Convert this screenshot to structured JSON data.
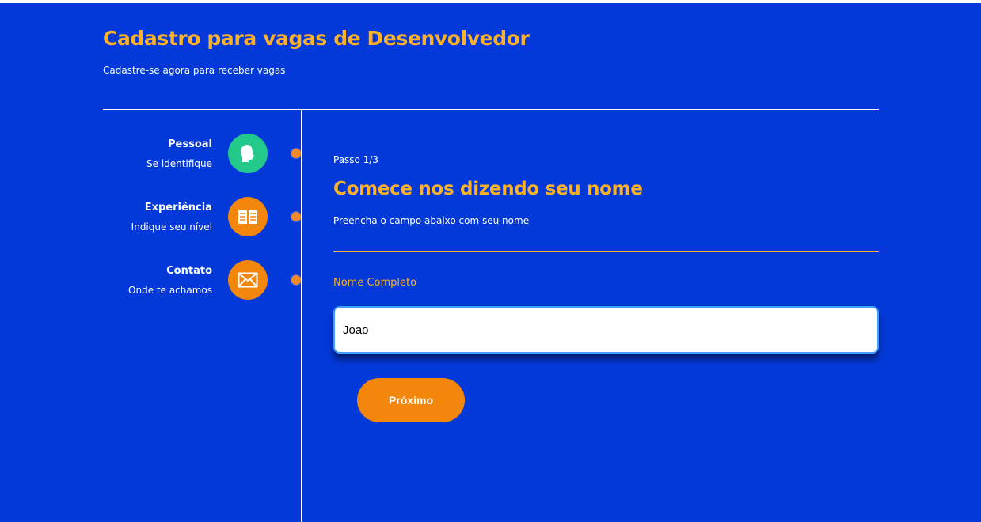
{
  "header": {
    "title": "Cadastro para vagas de Desenvolvedor",
    "subtitle": "Cadastre-se agora para receber vagas"
  },
  "steps": [
    {
      "name": "Pessoal",
      "description": "Se identifique",
      "icon": "person-head-icon",
      "color": "#22c98a"
    },
    {
      "name": "Experiência",
      "description": "Indique seu nível",
      "icon": "book-icon",
      "color": "#f2870c"
    },
    {
      "name": "Contato",
      "description": "Onde te achamos",
      "icon": "envelope-icon",
      "color": "#f2870c"
    }
  ],
  "content": {
    "step_counter": "Passo 1/3",
    "title": "Comece nos dizendo seu nome",
    "subtitle": "Preencha o campo abaixo com seu nome",
    "field_label": "Nome Completo",
    "name_value": "Joao",
    "next_label": "Próximo"
  },
  "colors": {
    "background": "#0339d8",
    "accent_yellow": "#fbb12b",
    "accent_orange": "#f2870c",
    "accent_green": "#22c98a"
  }
}
